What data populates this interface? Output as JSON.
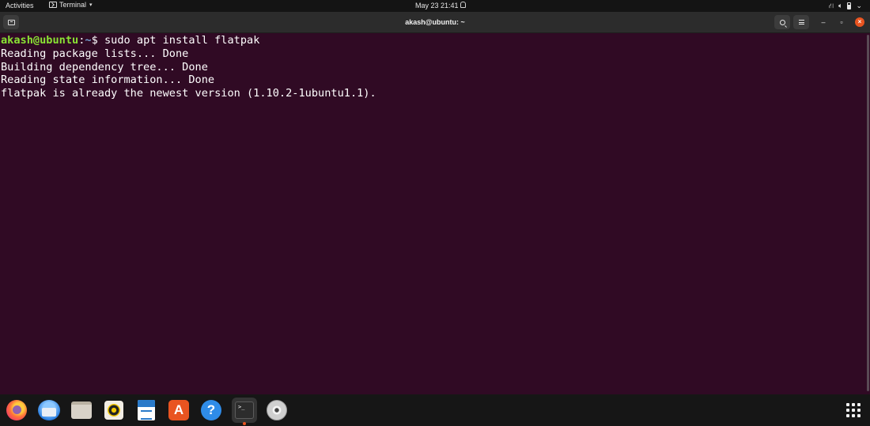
{
  "topbar": {
    "activities": "Activities",
    "app_name": "Terminal",
    "datetime": "May 23  21:41"
  },
  "window": {
    "title": "akash@ubuntu: ~"
  },
  "terminal": {
    "prompt_user": "akash@ubuntu",
    "prompt_sep": ":",
    "prompt_path": "~",
    "prompt_symbol": "$ ",
    "command": "sudo apt install flatpak",
    "output": [
      "Reading package lists... Done",
      "Building dependency tree... Done",
      "Reading state information... Done",
      "flatpak is already the newest version (1.10.2-1ubuntu1.1)."
    ]
  },
  "dock": {
    "items": [
      "firefox",
      "thunderbird",
      "files",
      "rhythmbox",
      "libreoffice-writer",
      "ubuntu-software",
      "help",
      "terminal",
      "disc"
    ],
    "active": "terminal",
    "software_glyph": "A",
    "help_glyph": "?",
    "terminal_glyph": ">_"
  },
  "colors": {
    "terminal_bg": "#300a24",
    "prompt_user": "#8ae234",
    "prompt_path": "#729fcf",
    "accent": "#e95420"
  }
}
